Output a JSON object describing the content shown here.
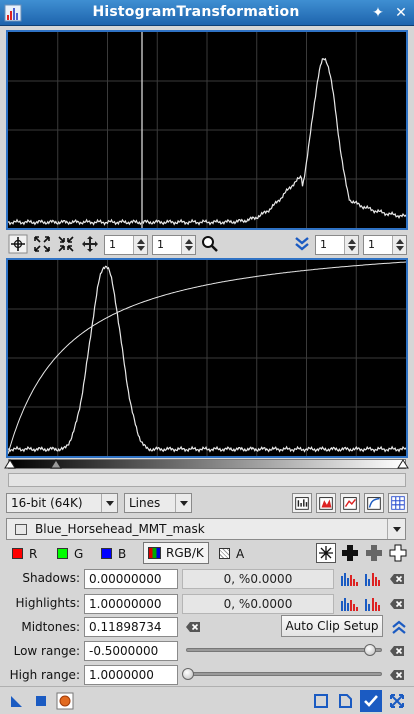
{
  "window": {
    "title": "HistogramTransformation",
    "title_icon": "histogram-app-icon",
    "controls": [
      "pin-icon",
      "close-icon"
    ]
  },
  "toolbar": {
    "icons": [
      "crosshair-icon",
      "zoom-fit-icon",
      "zoom-extents-icon",
      "pan-icon",
      "zoom-icon",
      "reset-zoom-icon"
    ],
    "zoom_h_left": "1",
    "zoom_v_left": "1",
    "zoom_h_right": "1",
    "zoom_v_right": "1"
  },
  "histogram_panels": {
    "input": {
      "description_visible": false
    },
    "output": {
      "description_visible": false
    }
  },
  "controls": {
    "resolution": "16-bit (64K)",
    "plot_style": "Lines",
    "view": "Blue_Horsehead_MMT_mask"
  },
  "channels": {
    "r": {
      "label": "R",
      "color": "#ff0000"
    },
    "g": {
      "label": "G",
      "color": "#00ff00"
    },
    "b": {
      "label": "B",
      "color": "#0000ff"
    },
    "rgbk": {
      "label": "RGB/K"
    },
    "a": {
      "label": "A"
    }
  },
  "params": {
    "shadows_label": "Shadows:",
    "shadows": "0.00000000",
    "shadows_readout": "0, %0.0000",
    "highlights_label": "Highlights:",
    "highlights": "1.00000000",
    "highlights_readout": "0, %0.0000",
    "midtones_label": "Midtones:",
    "midtones": "0.11898734",
    "auto_clip_label": "Auto Clip Setup",
    "low_range_label": "Low range:",
    "low_range": "-0.5000000",
    "high_range_label": "High range:",
    "high_range": "1.0000000"
  },
  "colors": {
    "titlebar": "#2a78c2",
    "panel_border": "#2f72c4",
    "plot_bg": "#000000",
    "grid": "#3a3a3a",
    "curve": "#e8e8e8"
  }
}
